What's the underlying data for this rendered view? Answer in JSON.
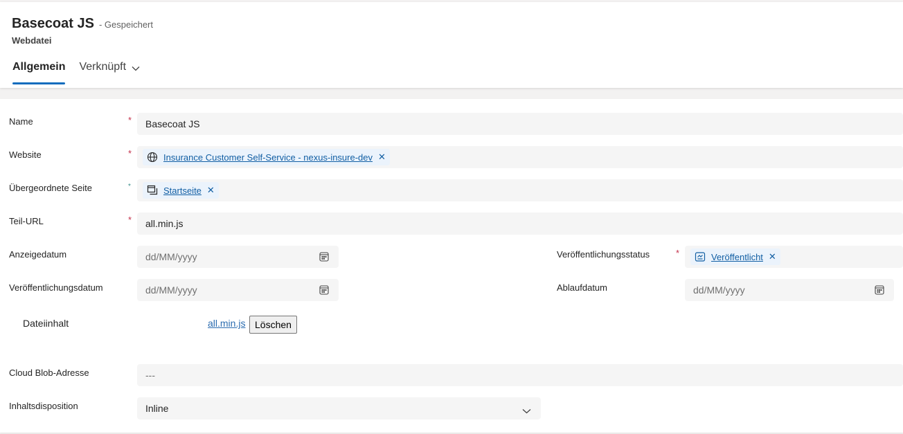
{
  "header": {
    "title": "Basecoat JS",
    "saved_status": "- Gespeichert",
    "entity_type": "Webdatei",
    "tabs": [
      {
        "label": "Allgemein",
        "active": true
      },
      {
        "label": "Verknüpft",
        "active": false
      }
    ]
  },
  "form": {
    "name": {
      "label": "Name",
      "required": "*",
      "value": "Basecoat JS"
    },
    "website": {
      "label": "Website",
      "required": "*",
      "value": "Insurance Customer Self-Service - nexus-insure-dev",
      "icon": "globe-icon"
    },
    "parent_page": {
      "label": "Übergeordnete Seite",
      "required": "*",
      "value": "Startseite",
      "icon": "page-icon"
    },
    "partial_url": {
      "label": "Teil-URL",
      "required": "*",
      "value": "all.min.js"
    },
    "display_date": {
      "label": "Anzeigedatum",
      "placeholder": "dd/MM/yyyy"
    },
    "publish_status": {
      "label": "Veröffentlichungsstatus",
      "required": "*",
      "value": "Veröffentlicht",
      "icon": "status-icon"
    },
    "publish_date": {
      "label": "Veröffentlichungsdatum",
      "placeholder": "dd/MM/yyyy"
    },
    "expiry_date": {
      "label": "Ablaufdatum",
      "placeholder": "dd/MM/yyyy"
    },
    "file_content": {
      "label": "Dateiinhalt",
      "file_name": "all.min.js",
      "delete_label": "Löschen"
    },
    "cloud_blob": {
      "label": "Cloud Blob-Adresse",
      "value": "---"
    },
    "content_disposition": {
      "label": "Inhaltsdisposition",
      "value": "Inline"
    }
  },
  "colors": {
    "accent": "#0f6cbd",
    "required": "#c4314b",
    "link": "#115ea3"
  }
}
